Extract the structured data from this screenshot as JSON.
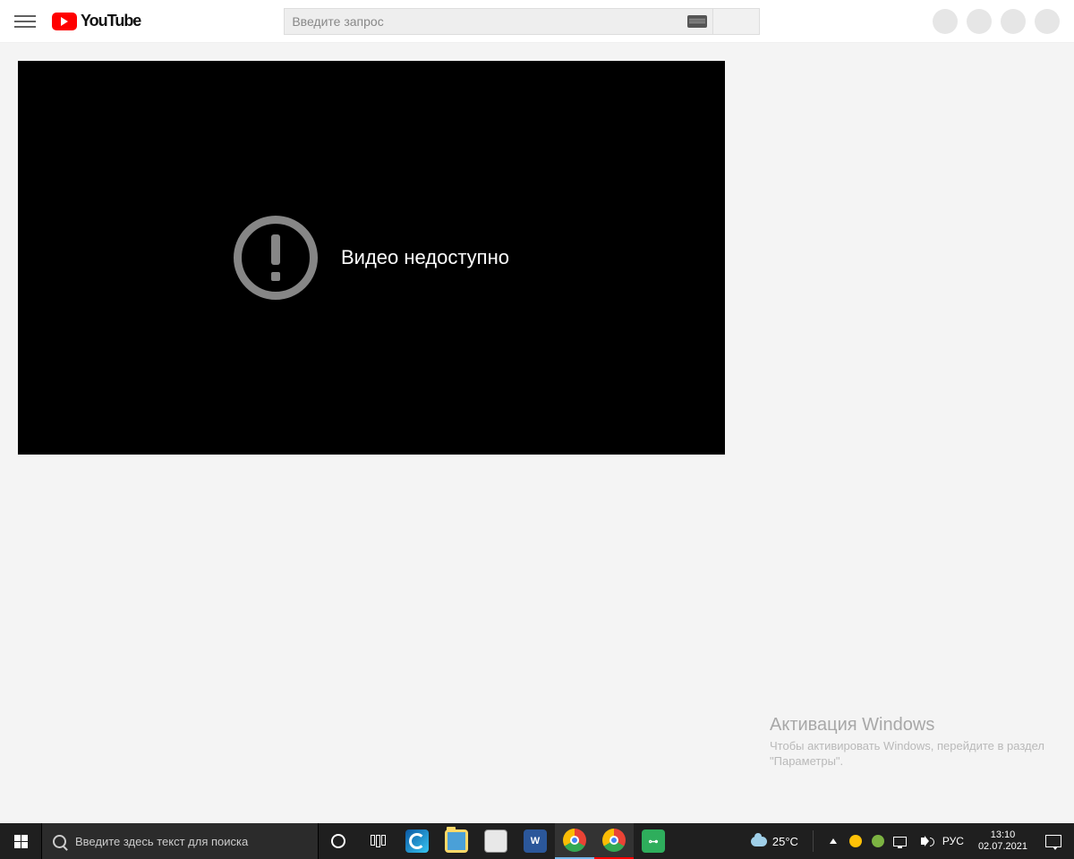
{
  "header": {
    "logo_text": "YouTube",
    "search_placeholder": "Введите запрос"
  },
  "video_error": {
    "message": "Видео недоступно"
  },
  "watermark": {
    "title": "Активация Windows",
    "subtitle": "Чтобы активировать Windows, перейдите в раздел \"Параметры\"."
  },
  "taskbar": {
    "search_placeholder": "Введите здесь текст для поиска",
    "word_label": "W",
    "key_label": "⊶",
    "weather_temp": "25°C",
    "language": "РУС",
    "time": "13:10",
    "date": "02.07.2021"
  }
}
